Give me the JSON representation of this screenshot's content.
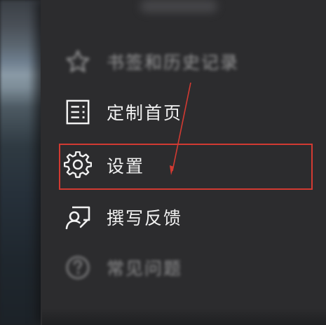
{
  "menu": {
    "items": [
      {
        "label": "书签和历史记录",
        "icon": "star-icon"
      },
      {
        "label": "定制首页",
        "icon": "list-icon"
      },
      {
        "label": "设置",
        "icon": "gear-icon"
      },
      {
        "label": "撰写反馈",
        "icon": "feedback-icon"
      },
      {
        "label": "常见问题",
        "icon": "question-icon"
      }
    ]
  },
  "annotation": {
    "highlight_color": "#d23a32",
    "highlighted_item": "设置"
  }
}
